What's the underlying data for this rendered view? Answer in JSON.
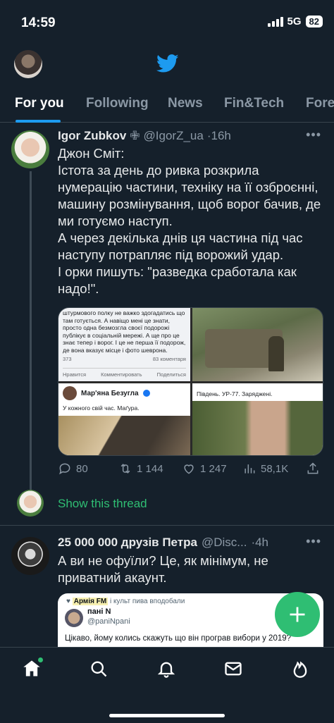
{
  "status": {
    "time": "14:59",
    "network": "5G",
    "battery": "82"
  },
  "tabs": [
    {
      "label": "For you",
      "active": true
    },
    {
      "label": "Following"
    },
    {
      "label": "News"
    },
    {
      "label": "Fin&Tech"
    },
    {
      "label": "Fore"
    }
  ],
  "tweet1": {
    "name": "Igor Zubkov",
    "badge": "✙",
    "handle": "@IgorZ_ua",
    "time": "·16h",
    "lines": [
      "Джон Сміт:",
      "Істота за день до ривка розкрила нумерацію частини, техніку на її озброєнні, машину розмінування, щоб ворог бачив, де ми готуємо наступ.",
      "А через декілька днів ця частина під час наступу потрапляє під ворожий удар.",
      "І орки пишуть: \"разведка сработала как надо!\"."
    ],
    "media": {
      "post_text": "штурмового полку не важко здогадатись що там готується. А навіщо мені це знати, просто одна безмозгла своєї подорожі публікує в соціальній мережі. А ще про це знає тепер і ворог. І це не перша її подорож, де вона вказує місце і фото шеврона.",
      "reactions_count": "373",
      "comments_count": "83 коментаря",
      "like_label": "Нравится",
      "comment_label": "Комментировать",
      "share_label": "Поделиться",
      "fb_name": "Мар'яна Безугла",
      "fb_text": "У кожного свій час. Маґура.",
      "caption": "Південь. УР-77. Заряджені."
    },
    "stats": {
      "replies": "80",
      "retweets": "1 144",
      "likes": "1 247",
      "views": "58,1K"
    }
  },
  "show_thread": "Show this thread",
  "tweet2": {
    "name": "25 000 000 друзів Петра",
    "handle": "@Disc...",
    "time": "·4h",
    "text": "А ви не офуїли? Це, як мінімум, не приватний акаунт.",
    "quote": {
      "top_bold": "Армія FM",
      "top_rest": "і культ пива вподобали",
      "name": "пані N",
      "handle": "@paniNpani",
      "text": "Цікаво, йому колись скажуть що він програв вибори у 2019?"
    }
  },
  "colors": {
    "accent": "#1d9bf0",
    "fab": "#2fbe73",
    "background": "#15202b"
  },
  "icons": [
    "twitter-bird-icon",
    "reply-icon",
    "retweet-icon",
    "like-icon",
    "views-icon",
    "share-icon",
    "compose-plus-icon",
    "home-icon",
    "search-icon",
    "bell-icon",
    "mail-icon",
    "fire-icon"
  ]
}
